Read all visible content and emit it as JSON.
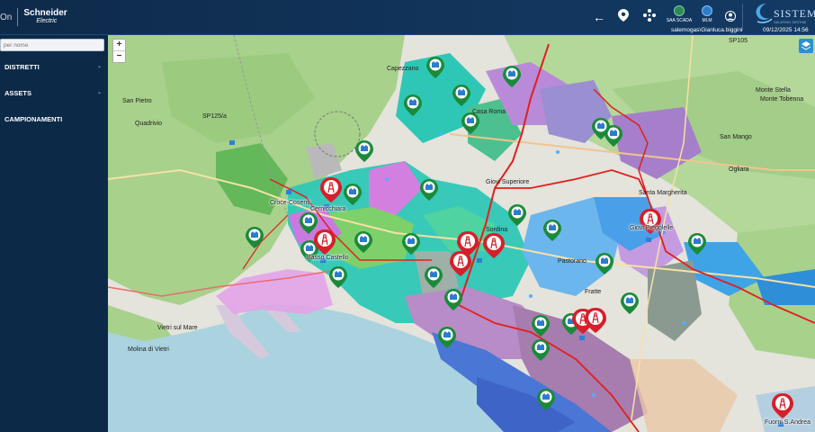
{
  "header": {
    "brand_prefix": "On",
    "brand_name": "Schneider",
    "brand_sub": "Electric",
    "icons": [
      "back-arrow-icon",
      "location-pin-icon",
      "network-icon",
      "scada-icon",
      "mlm-icon",
      "user-icon"
    ],
    "badge_scada": "SAA SCADA",
    "badge_mlm": "MLM",
    "user": "salemogas\\Gianluca.biggini",
    "datetime": "09/12/2025 14:56",
    "partner_logo": "SISTEMI",
    "partner_sub": "SALERNO SISTEMI"
  },
  "sidebar": {
    "search_placeholder": "per nome",
    "items": [
      {
        "label": "DISTRETTI",
        "has_chevron": true
      },
      {
        "label": "ASSETS",
        "has_chevron": true
      },
      {
        "label": "CAMPIONAMENTI",
        "has_chevron": false
      }
    ]
  },
  "map": {
    "zoom_in": "+",
    "zoom_out": "−",
    "labels": [
      {
        "text": "Croce-Cosenti"
      },
      {
        "text": "Cernicchiara"
      },
      {
        "text": "Basso Castello"
      },
      {
        "text": "Giovi Piegolelle"
      },
      {
        "text": "Fuorni S.Andrea"
      },
      {
        "text": "San Pietro"
      },
      {
        "text": "Capezzano"
      },
      {
        "text": "SP125/a"
      },
      {
        "text": "SP105"
      },
      {
        "text": "Monte Stella"
      },
      {
        "text": "Giovi Superiore"
      },
      {
        "text": "Santa Margherita"
      },
      {
        "text": "Sordina"
      },
      {
        "text": "Pastorano"
      },
      {
        "text": "Casa Roma"
      },
      {
        "text": "Fratte"
      },
      {
        "text": "Vietri sul Mare"
      },
      {
        "text": "Molina di Vietri"
      },
      {
        "text": "Quadrivio"
      },
      {
        "text": "San Mango"
      },
      {
        "text": "Ogliara"
      },
      {
        "text": "Monte Tobenna"
      }
    ],
    "colors": {
      "sea": "#aad3df",
      "land": "#e7e6e1",
      "forest": "#8fc675",
      "teal": "#1fc7b8",
      "magenta": "#d98be0",
      "violet": "#a98fd6",
      "blue": "#4a86d9",
      "orange": "#f2c59b",
      "pipeline": "#e11f1f"
    },
    "markers": {
      "green_pins": 28,
      "red_tower_pins": 9
    }
  }
}
